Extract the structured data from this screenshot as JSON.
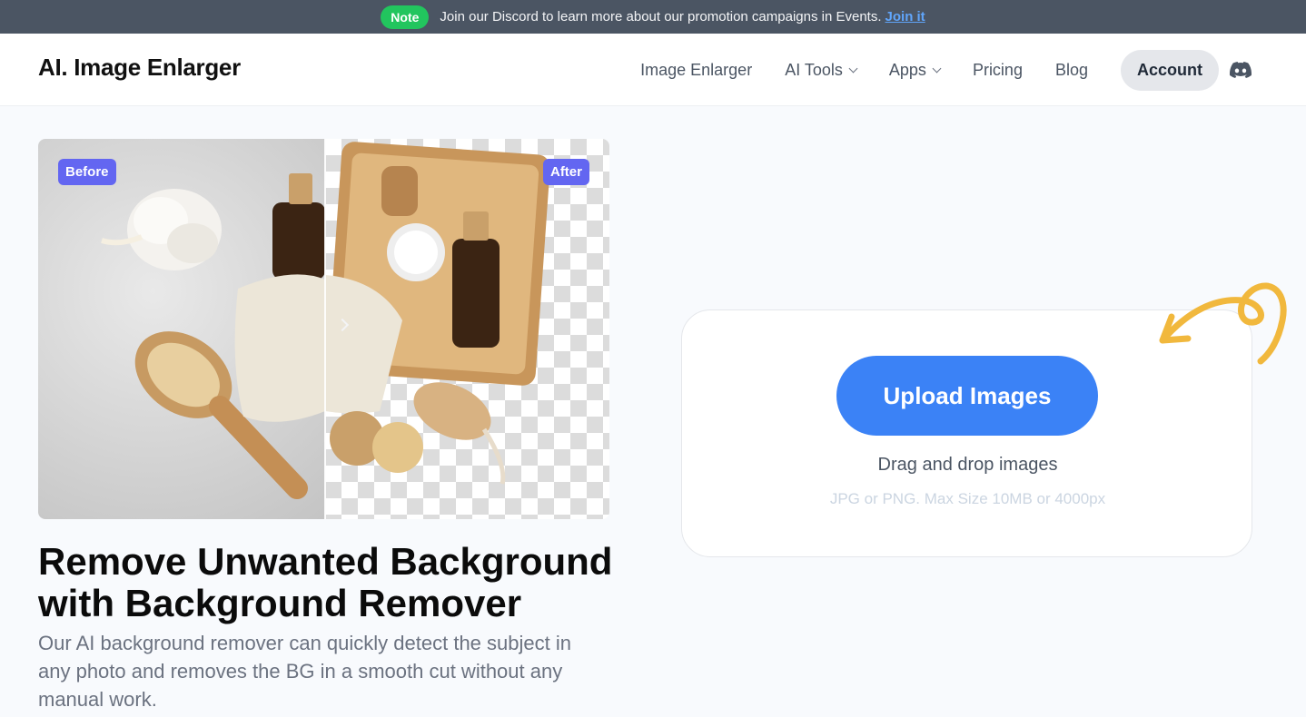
{
  "banner": {
    "badge": "Note",
    "text": "Join our Discord to learn more about our promotion campaigns in Events.",
    "link": "Join it"
  },
  "header": {
    "logo": "AI. Image Enlarger",
    "nav": [
      {
        "label": "Image Enlarger"
      },
      {
        "label": "AI Tools"
      },
      {
        "label": "Apps"
      },
      {
        "label": "Pricing"
      },
      {
        "label": "Blog"
      }
    ],
    "account": "Account",
    "discord_icon": "discord-icon"
  },
  "compare": {
    "before_label": "Before",
    "after_label": "After"
  },
  "hero": {
    "title": "Remove Unwanted Background with Background Remover",
    "description": "Our AI background remover can quickly detect the subject in any photo and removes the BG in a smooth cut without any manual work."
  },
  "upload": {
    "button": "Upload Images",
    "drag_text": "Drag and drop images",
    "limits": "JPG or PNG. Max Size 10MB or 4000px"
  },
  "colors": {
    "banner_bg": "#4b5563",
    "note_green": "#22c55e",
    "primary_blue": "#3b82f6",
    "tag_purple": "#6366f1",
    "accent_yellow": "#f1b83d"
  }
}
